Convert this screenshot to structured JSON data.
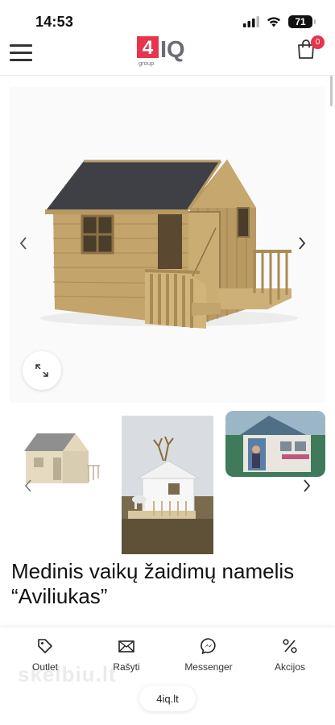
{
  "status_bar": {
    "time": "14:53",
    "battery": "71"
  },
  "header": {
    "logo_text": "4IQ",
    "logo_sub": "group",
    "cart_count": "0",
    "brand_red": "#e8344e",
    "brand_gray": "#6a6c75"
  },
  "product": {
    "title": "Medinis vaikų žaidimų namelis “Aviliukas”",
    "gallery_images": [
      "wooden-playhouse-main",
      "playhouse-white-thumb",
      "playhouse-deer-photo-thumb",
      "playhouse-blue-photo-thumb"
    ]
  },
  "bottom_nav": {
    "items": [
      {
        "label": "Outlet",
        "icon": "tag-icon"
      },
      {
        "label": "Rašyti",
        "icon": "envelope-icon"
      },
      {
        "label": "Messenger",
        "icon": "messenger-icon"
      },
      {
        "label": "Akcijos",
        "icon": "percent-icon"
      }
    ]
  },
  "browser": {
    "url": "4iq.lt"
  },
  "watermark": "skelbiu.lt"
}
